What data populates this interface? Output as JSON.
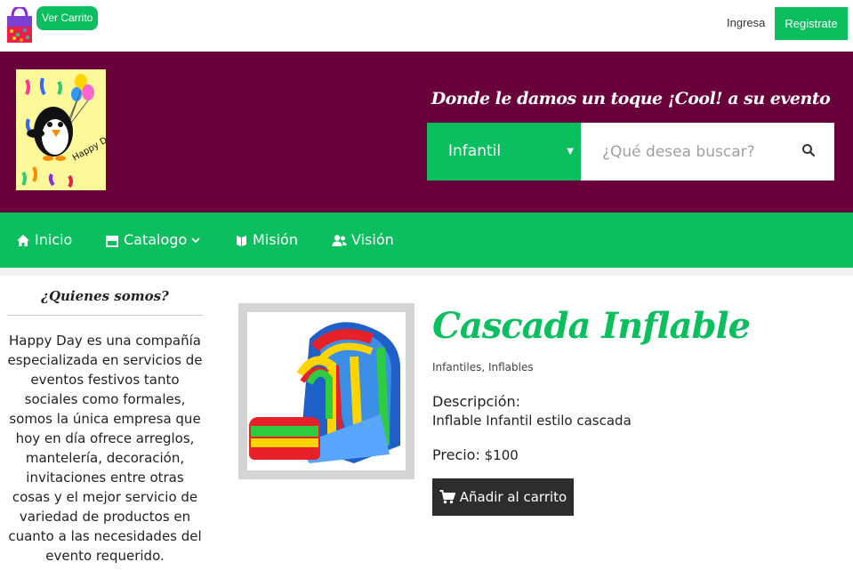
{
  "topbar": {
    "cart_button": "Ver Carrito",
    "login": "Ingresa",
    "register": "Registrate"
  },
  "header": {
    "logo_text": "Happy Day",
    "tagline": "Donde le damos un toque ¡Cool! a su evento",
    "category_selected": "Infantil",
    "search_placeholder": "¿Qué desea buscar?"
  },
  "nav": {
    "inicio": "Inicio",
    "catalogo": "Catalogo",
    "mision": "Misión",
    "vision": "Visión"
  },
  "sidebar": {
    "title": "¿Quienes somos?",
    "brand": "Happy Day",
    "text": " es una compañía especializada en servicios de eventos festivos tanto sociales como formales, somos la única empresa que hoy en día ofrece arreglos, mantelería, decoración, invitaciones entre otras cosas y el mejor servicio de variedad de productos en cuanto a las necesidades del evento requerido."
  },
  "product": {
    "title": "Cascada Inflable",
    "categories": "Infantiles, Inflables",
    "desc_label": "Descripción:",
    "desc_value": "Inflable Infantil estilo cascada",
    "price_label": "Precio:",
    "price_value": "$100",
    "add_button": "Añadir al carrito"
  },
  "colors": {
    "accent": "#0bbf5f",
    "header_bg": "#6a003b",
    "button_dark": "#2d2d2d"
  },
  "icons": [
    "shopping-bag-icon",
    "search-icon",
    "home-icon",
    "store-icon",
    "chevron-down-icon",
    "book-icon",
    "users-icon",
    "cart-icon"
  ]
}
